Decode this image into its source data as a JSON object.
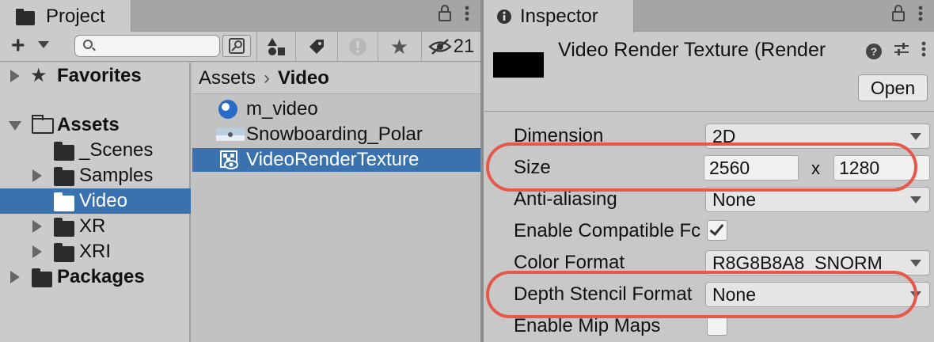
{
  "project": {
    "tab_label": "Project",
    "lock_icon": "lock-icon",
    "menu_icon": "kebab-menu-icon",
    "toolbar": {
      "search_placeholder": "",
      "hidden_count": "21"
    },
    "tree": {
      "favorites": "Favorites",
      "assets": "Assets",
      "scenes": "_Scenes",
      "samples": "Samples",
      "video": "Video",
      "xr": "XR",
      "xri": "XRI",
      "packages": "Packages"
    },
    "breadcrumb": {
      "root": "Assets",
      "current": "Video"
    },
    "files": [
      {
        "label": "m_video",
        "icon": "video-player-icon"
      },
      {
        "label": "Snowboarding_Polar",
        "icon": "video-clip-thumbnail-icon"
      },
      {
        "label": "VideoRenderTexture",
        "icon": "render-texture-icon",
        "selected": true
      }
    ]
  },
  "inspector": {
    "tab_label": "Inspector",
    "title": "Video Render Texture (Render",
    "open_label": "Open",
    "props": {
      "dimension": {
        "label": "Dimension",
        "value": "2D"
      },
      "size": {
        "label": "Size",
        "width": "2560",
        "sep": "x",
        "height": "1280"
      },
      "anti_aliasing": {
        "label": "Anti-aliasing",
        "value": "None"
      },
      "compatible_format": {
        "label": "Enable Compatible Fc",
        "checked": true
      },
      "color_format": {
        "label": "Color Format",
        "value": "R8G8B8A8_SNORM"
      },
      "depth_stencil": {
        "label": "Depth Stencil Format",
        "value": "None"
      },
      "mip_maps": {
        "label": "Enable Mip Maps",
        "checked": false
      }
    }
  },
  "colors": {
    "selection": "#3a72b0",
    "highlight": "#e5584a"
  }
}
